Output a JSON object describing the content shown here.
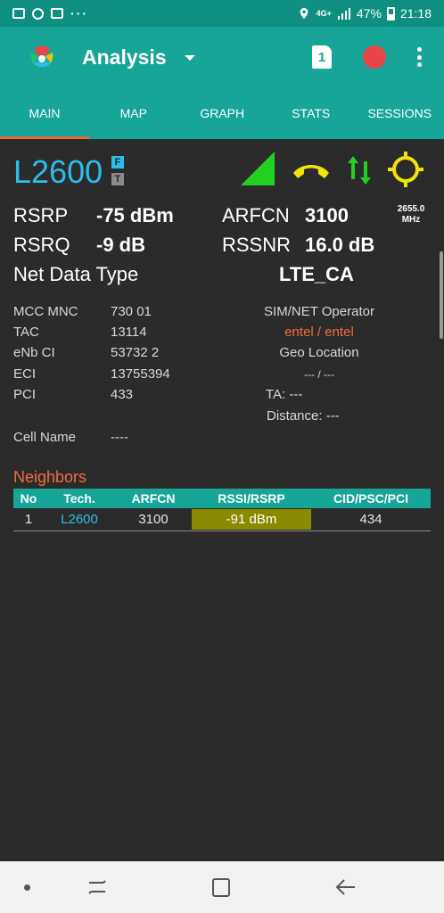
{
  "status_bar": {
    "network": "4G+",
    "battery": "47%",
    "time": "21:18",
    "dots": "···"
  },
  "app_bar": {
    "title": "Analysis",
    "sim_slot": "1"
  },
  "tabs": [
    {
      "label": "MAIN",
      "active": true
    },
    {
      "label": "MAP",
      "active": false
    },
    {
      "label": "GRAPH",
      "active": false
    },
    {
      "label": "STATS",
      "active": false
    },
    {
      "label": "SESSIONS",
      "active": false
    }
  ],
  "main": {
    "technology": "L2600",
    "badge_f": "F",
    "badge_t": "T",
    "rsrp_label": "RSRP",
    "rsrp_value": "-75 dBm",
    "arfcn_label": "ARFCN",
    "arfcn_value": "3100",
    "freq_line1": "2655.0",
    "freq_line2": "MHz",
    "rsrq_label": "RSRQ",
    "rsrq_value": "-9 dB",
    "rssnr_label": "RSSNR",
    "rssnr_value": "16.0 dB",
    "net_data_type_label": "Net Data Type",
    "net_data_type_value": "LTE_CA",
    "mcc_mnc_label": "MCC MNC",
    "mcc_mnc_value": "730 01",
    "tac_label": "TAC",
    "tac_value": "13114",
    "enb_ci_label": "eNb CI",
    "enb_ci_value": "53732 2",
    "eci_label": "ECI",
    "eci_value": "13755394",
    "pci_label": "PCI",
    "pci_value": "433",
    "sim_net_operator_label": "SIM/NET Operator",
    "sim_net_operator_value": "entel / entel",
    "geo_location_label": "Geo Location",
    "geo_location_value": "--- / ---",
    "ta_text": "TA: ---",
    "distance_text": "Distance: ---",
    "cell_name_label": "Cell Name",
    "cell_name_value": "----"
  },
  "neighbors": {
    "title": "Neighbors",
    "headers": [
      "No",
      "Tech.",
      "ARFCN",
      "RSSI/RSRP",
      "CID/PSC/PCI"
    ],
    "rows": [
      {
        "no": "1",
        "tech": "L2600",
        "arfcn": "3100",
        "rssi_rsrp": "-91 dBm",
        "cid": "434"
      }
    ]
  },
  "colors": {
    "accent": "#16a596",
    "tech_blue": "#2bbdeb",
    "orange": "#f26b3a",
    "signal_green": "#22d022",
    "call_yellow": "#f2e40b"
  }
}
